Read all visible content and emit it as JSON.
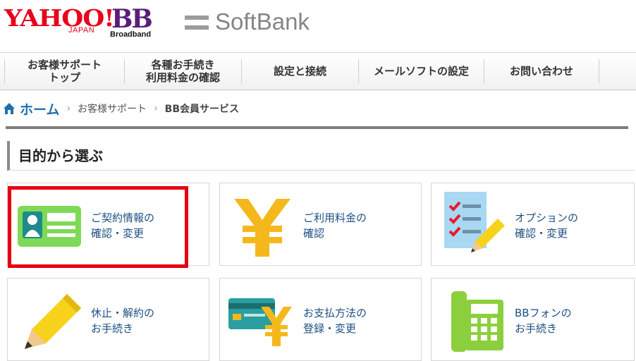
{
  "header": {
    "yahoo_logo": "YAHOO!",
    "yahoo_sub": "JAPAN",
    "bb_logo": "BB",
    "bb_sub": "Broadband",
    "softbank_logo": "SoftBank"
  },
  "nav": [
    {
      "label": "お客様サポート\nトップ"
    },
    {
      "label": "各種お手続き\n利用料金の確認"
    },
    {
      "label": "設定と接続"
    },
    {
      "label": "メールソフトの設定"
    },
    {
      "label": "お問い合わせ"
    }
  ],
  "breadcrumb": {
    "home": "ホーム",
    "sep": "›",
    "support": "お客様サポート",
    "current": "BB会員サービス"
  },
  "section": {
    "title": "目的から選ぶ"
  },
  "tiles": [
    {
      "label": "ご契約情報の\n確認・変更",
      "icon": "id-card-icon"
    },
    {
      "label": "ご利用料金の\n確認",
      "icon": "yen-icon"
    },
    {
      "label": "オプションの\n確認・変更",
      "icon": "checklist-pencil-icon"
    },
    {
      "label": "休止・解約の\nお手続き",
      "icon": "pencil-icon"
    },
    {
      "label": "お支払方法の\n登録・変更",
      "icon": "card-yen-icon"
    },
    {
      "label": "BBフォンの\nお手続き",
      "icon": "phone-icon"
    }
  ],
  "colors": {
    "accent_red": "#e60012",
    "link_blue": "#1d4f83",
    "yen_gold": "#f5b81c",
    "id_green": "#7ed957",
    "phone_green": "#8ccf3c"
  }
}
